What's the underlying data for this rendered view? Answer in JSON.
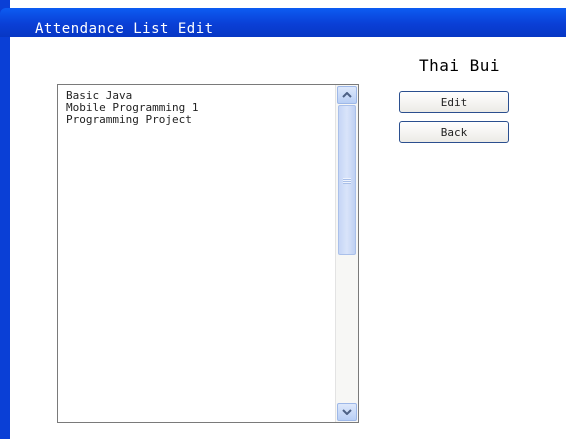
{
  "window": {
    "title": "Attendance List Edit"
  },
  "header": {
    "user_name": "Thai Bui"
  },
  "list": {
    "items": [
      "Basic Java",
      "Mobile Programming 1",
      "Programming Project"
    ]
  },
  "actions": {
    "edit_label": "Edit",
    "back_label": "Back"
  },
  "icons": {
    "scroll_up": "chevron-up-icon",
    "scroll_down": "chevron-down-icon"
  },
  "colors": {
    "titlebar": "#0a3fd6",
    "button_border": "#2b4f8f",
    "scrollbar": "#b9cff5"
  }
}
